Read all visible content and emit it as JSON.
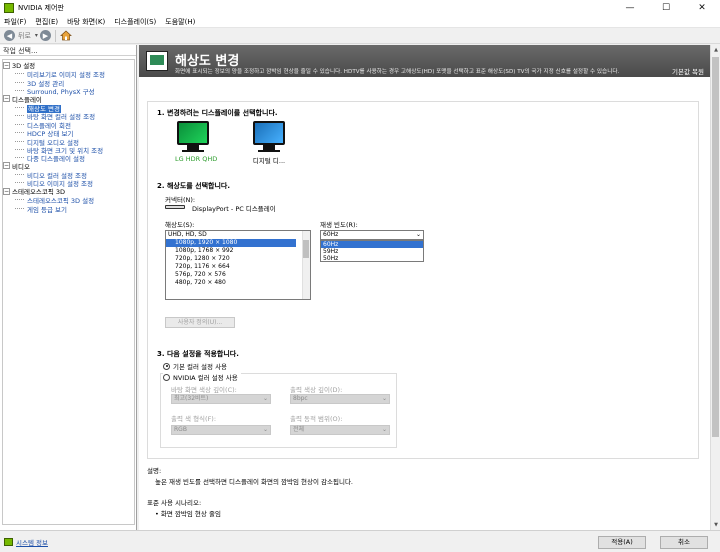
{
  "window": {
    "title": "NVIDIA 제어판",
    "controls": {
      "minimize": "—",
      "maximize": "☐",
      "close": "✕"
    }
  },
  "menu": [
    "파일(F)",
    "편집(E)",
    "바탕 화면(K)",
    "디스플레이(S)",
    "도움말(H)"
  ],
  "toolbar": {
    "back_label": "뒤로",
    "dropdown": "▾"
  },
  "left": {
    "header": "작업 선택...",
    "tree": [
      {
        "label": "3D 설정",
        "items": [
          "미리보기로 이미지 설정 조정",
          "3D 설정 관리",
          "Surround, PhysX 구성"
        ]
      },
      {
        "label": "디스플레이",
        "items": [
          "해상도 변경",
          "바탕 화면 컬러 설정 조정",
          "디스플레이 회전",
          "HDCP 상태 보기",
          "디지털 오디오 설정",
          "바탕 화면 크기 및 위치 조정",
          "다중 디스플레이 설정"
        ],
        "selected_index": 0
      },
      {
        "label": "비디오",
        "items": [
          "비디오 컬러 설정 조정",
          "비디오 이미지 설정 조정"
        ]
      },
      {
        "label": "스테레오스코픽 3D",
        "items": [
          "스테레오스코픽 3D 설정",
          "게임 등급 보기"
        ]
      }
    ]
  },
  "banner": {
    "title": "해상도 변경",
    "description": "화면에 표시되는 정보의 양을 조정하고 깜박임 현상을 줄일 수 있습니다. HDTV를 사용하는 경우 고해상도(HD) 포맷을 선택하고 표준 해상도(SD) TV의 국가 지정 신호를 설정할 수 있습니다.",
    "restore": "기본값 복원"
  },
  "step1": {
    "title": "1. 변경하려는 디스플레이를 선택합니다.",
    "monitors": [
      {
        "label": "LG HDR QHD",
        "selected": true
      },
      {
        "label": "디지털 디...",
        "selected": false
      }
    ]
  },
  "step2": {
    "title": "2. 해상도를 선택합니다.",
    "connector_label": "커넥터(N):",
    "connector_value": "DisplayPort - PC 디스플레이",
    "resolution_label": "해상도(S):",
    "resolution_group": "UHD, HD, SD",
    "resolutions": [
      "1080p, 1920 × 1080",
      "1080p, 1768 × 992",
      "720p, 1280 × 720",
      "720p, 1176 × 664",
      "576p, 720 × 576",
      "480p, 720 × 480"
    ],
    "selected_resolution_index": 0,
    "refresh_label": "재생 빈도(R):",
    "refresh_value": "60Hz",
    "refresh_options": [
      "60Hz",
      "59Hz",
      "50Hz"
    ],
    "selected_refresh_index": 0,
    "custom_button": "사용자 정의(U)..."
  },
  "step3": {
    "title": "3. 다음 설정을 적용합니다.",
    "radio_default": "기본 컬러 설정 사용",
    "radio_nvidia": "NVIDIA 컬러 설정 사용",
    "desktop_depth_label": "바탕 화면 색상 깊이(C):",
    "desktop_depth_value": "최고(32비트)",
    "output_depth_label": "출력 색상 깊이(D):",
    "output_depth_value": "8bpc",
    "output_format_label": "출력 색 형식(F):",
    "output_format_value": "RGB",
    "output_range_label": "출력 동적 범위(O):",
    "output_range_value": "전체"
  },
  "description": {
    "label": "설명:",
    "text": "높은 재생 빈도를 선택하면 디스플레이 화면의 깜박임 현상이 감소됩니다.",
    "scenario_label": "표준 사용 시나리오:",
    "scenario_item": "• 화면 깜박임 현상 줄임"
  },
  "status": {
    "sysinfo": "시스템 정보",
    "apply": "적용(A)",
    "cancel": "취소"
  }
}
